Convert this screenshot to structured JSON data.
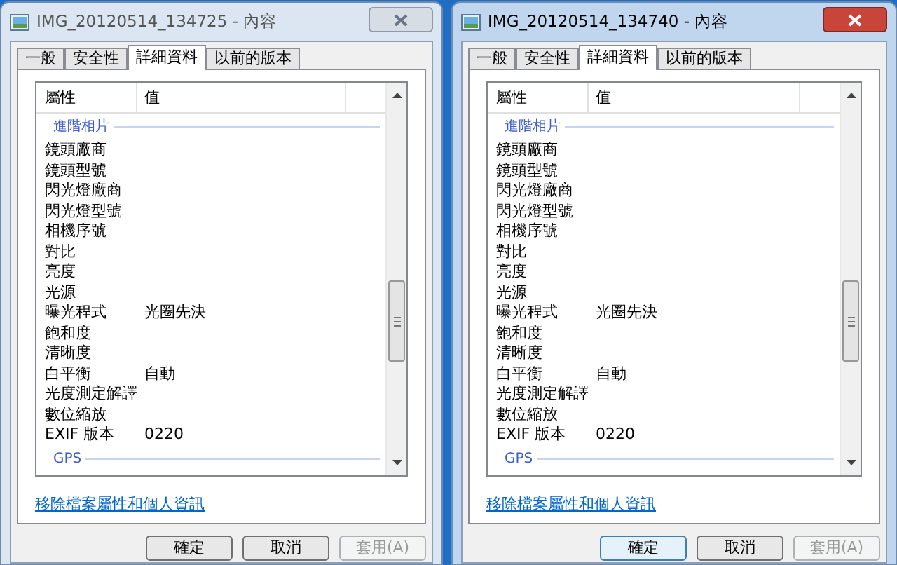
{
  "windows": [
    {
      "title": "IMG_20120514_134725 - 內容",
      "active": false,
      "tabs": [
        {
          "label": "一般",
          "selected": false
        },
        {
          "label": "安全性",
          "selected": false
        },
        {
          "label": "詳細資料",
          "selected": true
        },
        {
          "label": "以前的版本",
          "selected": false
        }
      ],
      "columns": [
        "屬性",
        "值"
      ],
      "sections": [
        {
          "title": "進階相片",
          "rows": [
            {
              "property": "鏡頭廠商"
            },
            {
              "property": "鏡頭型號"
            },
            {
              "property": "閃光燈廠商"
            },
            {
              "property": "閃光燈型號"
            },
            {
              "property": "相機序號"
            },
            {
              "property": "對比"
            },
            {
              "property": "亮度"
            },
            {
              "property": "光源"
            },
            {
              "property": "曝光程式",
              "value": "光圈先決"
            },
            {
              "property": "飽和度"
            },
            {
              "property": "清晰度"
            },
            {
              "property": "白平衡",
              "value": "自動"
            },
            {
              "property": "光度測定解譯"
            },
            {
              "property": "數位縮放"
            },
            {
              "property": "EXIF 版本",
              "value": "0220"
            }
          ]
        },
        {
          "title": "GPS"
        }
      ],
      "link": "移除檔案屬性和個人資訊",
      "buttons": [
        {
          "label": "確定",
          "disabled": false,
          "focused": false
        },
        {
          "label": "取消",
          "disabled": false,
          "focused": false
        },
        {
          "label": "套用(A)",
          "disabled": true,
          "focused": false
        }
      ]
    },
    {
      "title": "IMG_20120514_134740 - 內容",
      "active": true,
      "tabs": [
        {
          "label": "一般",
          "selected": false
        },
        {
          "label": "安全性",
          "selected": false
        },
        {
          "label": "詳細資料",
          "selected": true
        },
        {
          "label": "以前的版本",
          "selected": false
        }
      ],
      "columns": [
        "屬性",
        "值"
      ],
      "sections": [
        {
          "title": "進階相片",
          "rows": [
            {
              "property": "鏡頭廠商"
            },
            {
              "property": "鏡頭型號"
            },
            {
              "property": "閃光燈廠商"
            },
            {
              "property": "閃光燈型號"
            },
            {
              "property": "相機序號"
            },
            {
              "property": "對比"
            },
            {
              "property": "亮度"
            },
            {
              "property": "光源"
            },
            {
              "property": "曝光程式",
              "value": "光圈先決"
            },
            {
              "property": "飽和度"
            },
            {
              "property": "清晰度"
            },
            {
              "property": "白平衡",
              "value": "自動"
            },
            {
              "property": "光度測定解譯"
            },
            {
              "property": "數位縮放"
            },
            {
              "property": "EXIF 版本",
              "value": "0220"
            }
          ]
        },
        {
          "title": "GPS"
        }
      ],
      "link": "移除檔案屬性和個人資訊",
      "buttons": [
        {
          "label": "確定",
          "disabled": false,
          "focused": true
        },
        {
          "label": "取消",
          "disabled": false,
          "focused": false
        },
        {
          "label": "套用(A)",
          "disabled": true,
          "focused": false
        }
      ]
    }
  ]
}
